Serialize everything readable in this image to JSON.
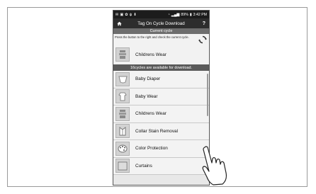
{
  "status_bar": {
    "left_icons": [
      "notification-icon",
      "image-icon",
      "settings-icon",
      "usb-icon",
      "download-icon"
    ],
    "battery": "89%",
    "time": "3:42 PM"
  },
  "title_bar": {
    "title": "Tag On Cycle Download",
    "help": "?"
  },
  "current_cycle": {
    "header": "Current cycle",
    "instruction": "Press the button to the right and check the current cycle.",
    "item": {
      "label": "Childrens Wear",
      "icon": "childrens-wear-icon"
    }
  },
  "available": {
    "header": "16cycles are available for download.",
    "items": [
      {
        "label": "Baby Diaper",
        "icon": "baby-diaper-icon"
      },
      {
        "label": "Baby Wear",
        "icon": "baby-wear-icon"
      },
      {
        "label": "Childrens Wear",
        "icon": "childrens-wear-icon"
      },
      {
        "label": "Collar Stain Removal",
        "icon": "collar-icon"
      },
      {
        "label": "Color Protection",
        "icon": "palette-icon"
      },
      {
        "label": "Curtains",
        "icon": "curtains-icon"
      }
    ]
  }
}
